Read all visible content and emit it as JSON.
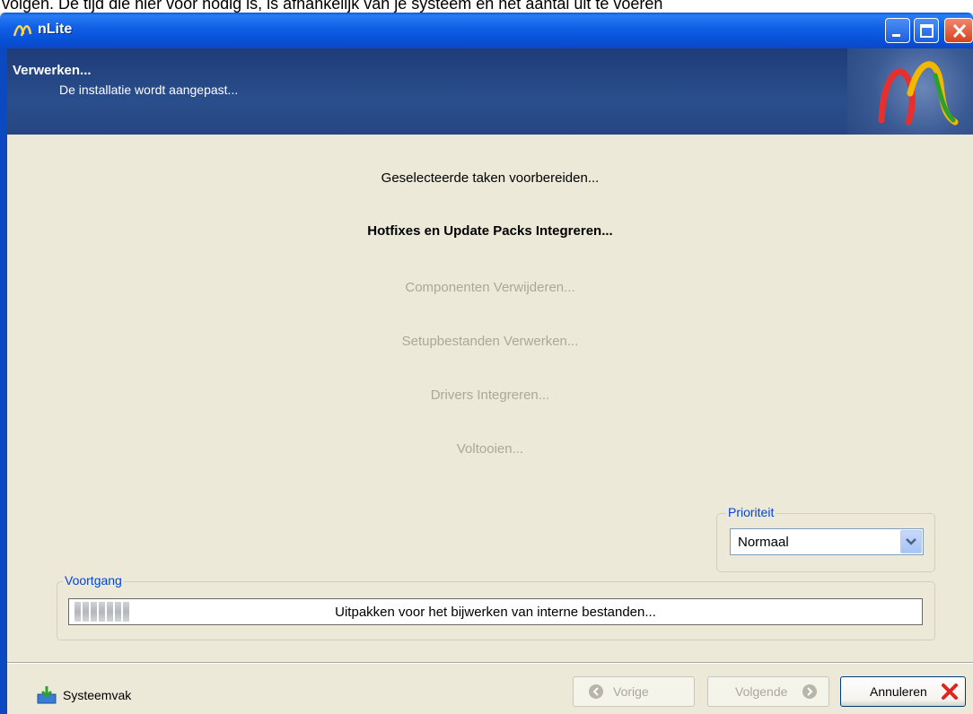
{
  "background_doc_text": "volgen. De tijd die hier voor nodig is, is afhankelijk van je systeem en het aantal uit te voeren",
  "window": {
    "title": "nLite"
  },
  "header": {
    "title": "Verwerken...",
    "subtitle": "De installatie wordt aangepast..."
  },
  "steps": [
    {
      "label": "Geselecteerde taken voorbereiden...",
      "state": "done"
    },
    {
      "label": "Hotfixes en Update Packs Integreren...",
      "state": "active"
    },
    {
      "label": "Componenten Verwijderen...",
      "state": "pending"
    },
    {
      "label": "Setupbestanden Verwerken...",
      "state": "pending"
    },
    {
      "label": "Drivers Integreren...",
      "state": "pending"
    },
    {
      "label": "Voltooien...",
      "state": "pending"
    }
  ],
  "priority": {
    "legend": "Prioriteit",
    "selected": "Normaal"
  },
  "progress": {
    "legend": "Voortgang",
    "status": "Uitpakken voor het bijwerken van interne bestanden...",
    "value": 0.07
  },
  "footer": {
    "systray_label": "Systeemvak",
    "back_label": "Vorige",
    "next_label": "Volgende",
    "cancel_label": "Annuleren"
  },
  "colors": {
    "titlebar": "#0a5bd8",
    "header_bg": "#254681",
    "dialog_bg": "#ece9d8",
    "legend_text": "#0046d5",
    "pending_text": "#aca899"
  }
}
